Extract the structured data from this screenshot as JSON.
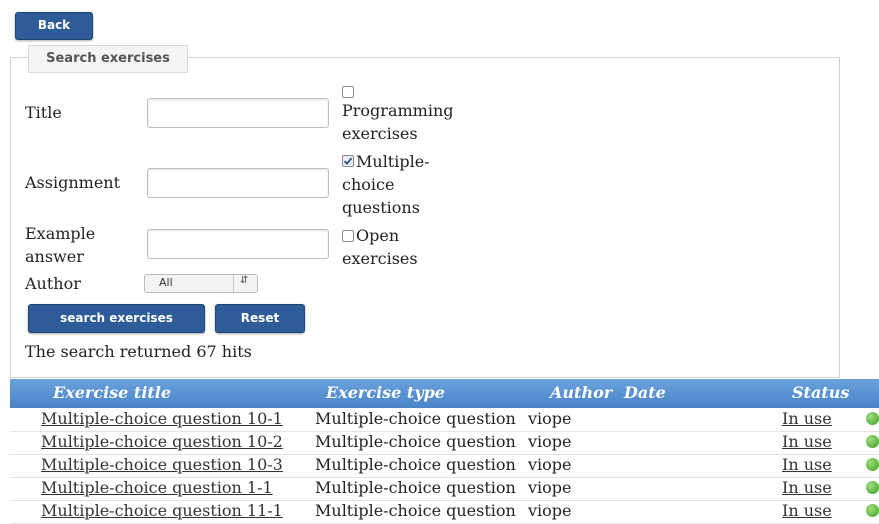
{
  "back_button": "Back",
  "search_panel": {
    "legend": "Search exercises",
    "fields": {
      "title_label": "Title",
      "assignment_label": "Assignment",
      "example_label_1": "Example",
      "example_label_2": "answer",
      "author_label": "Author",
      "author_value": "All"
    },
    "checkboxes": {
      "programming": {
        "line1": "Programming",
        "line2": "exercises",
        "checked": false
      },
      "multiple": {
        "line1": "Multiple-",
        "line2": "choice",
        "line3": "questions",
        "checked": true
      },
      "open": {
        "line1": "Open",
        "line2": "exercises",
        "checked": false
      }
    },
    "search_button": "search exercises",
    "reset_button": "Reset",
    "hits_text": "The search returned 67 hits"
  },
  "table": {
    "headers": {
      "title": "Exercise title",
      "type": "Exercise type",
      "author": "Author",
      "date": "Date",
      "status": "Status"
    },
    "rows": [
      {
        "title": "Multiple-choice question 10-1",
        "type": "Multiple-choice question",
        "author": "viope",
        "date": "",
        "status": "In use"
      },
      {
        "title": "Multiple-choice question 10-2",
        "type": "Multiple-choice question",
        "author": "viope",
        "date": "",
        "status": "In use"
      },
      {
        "title": "Multiple-choice question 10-3",
        "type": "Multiple-choice question",
        "author": "viope",
        "date": "",
        "status": "In use"
      },
      {
        "title": "Multiple-choice question 1-1",
        "type": "Multiple-choice question",
        "author": "viope",
        "date": "",
        "status": "In use"
      },
      {
        "title": "Multiple-choice question 11-1",
        "type": "Multiple-choice question",
        "author": "viope",
        "date": "",
        "status": "In use"
      }
    ]
  },
  "colors": {
    "button": "#2e5c98",
    "table_header": "#5a92d2",
    "status_icon": "#4caf2f"
  }
}
